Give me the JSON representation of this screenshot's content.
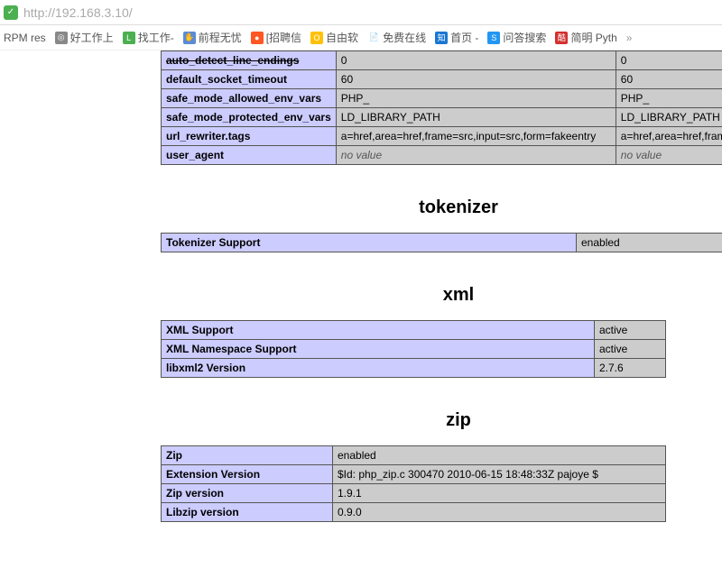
{
  "url_bar": {
    "url": "http://192.168.3.10/"
  },
  "bookmarks": [
    {
      "label": "RPM res",
      "icon": "",
      "bg": ""
    },
    {
      "label": "好工作上",
      "icon": "◎",
      "bg": "#888"
    },
    {
      "label": "找工作-",
      "icon": "L",
      "bg": "#4caf50"
    },
    {
      "label": "前程无忧",
      "icon": "✋",
      "bg": "#5b8bd4"
    },
    {
      "label": "[招聘信",
      "icon": "●",
      "bg": "#ff5722"
    },
    {
      "label": "自由软",
      "icon": "O",
      "bg": "#ffc107"
    },
    {
      "label": "免费在线",
      "icon": "📄",
      "bg": ""
    },
    {
      "label": "首页 -",
      "icon": "知",
      "bg": "#1976d2"
    },
    {
      "label": "问答搜索",
      "icon": "S",
      "bg": "#2196f3"
    },
    {
      "label": "简明 Pyth",
      "icon": "酷",
      "bg": "#d32f2f"
    }
  ],
  "chevron": "»",
  "top_rows": [
    {
      "k": "auto_detect_line_endings",
      "v1": "0",
      "v2": "0"
    },
    {
      "k": "default_socket_timeout",
      "v1": "60",
      "v2": "60"
    },
    {
      "k": "safe_mode_allowed_env_vars",
      "v1": "PHP_",
      "v2": "PHP_"
    },
    {
      "k": "safe_mode_protected_env_vars",
      "v1": "LD_LIBRARY_PATH",
      "v2": "LD_LIBRARY_PATH"
    },
    {
      "k": "url_rewriter.tags",
      "v1": "a=href,area=href,frame=src,input=src,form=fakeentry",
      "v2": "a=href,area=href,frame"
    },
    {
      "k": "user_agent",
      "v1": "no value",
      "v2": "no value",
      "italic": true
    }
  ],
  "sections": {
    "tokenizer": {
      "title": "tokenizer",
      "rows": [
        {
          "k": "Tokenizer Support",
          "v": "enabled"
        }
      ]
    },
    "xml": {
      "title": "xml",
      "rows": [
        {
          "k": "XML Support",
          "v": "active"
        },
        {
          "k": "XML Namespace Support",
          "v": "active"
        },
        {
          "k": "libxml2 Version",
          "v": "2.7.6"
        }
      ]
    },
    "zip": {
      "title": "zip",
      "rows": [
        {
          "k": "Zip",
          "v": "enabled"
        },
        {
          "k": "Extension Version",
          "v": "$Id: php_zip.c 300470 2010-06-15 18:48:33Z pajoye $"
        },
        {
          "k": "Zip version",
          "v": "1.9.1"
        },
        {
          "k": "Libzip version",
          "v": "0.9.0"
        }
      ]
    }
  }
}
